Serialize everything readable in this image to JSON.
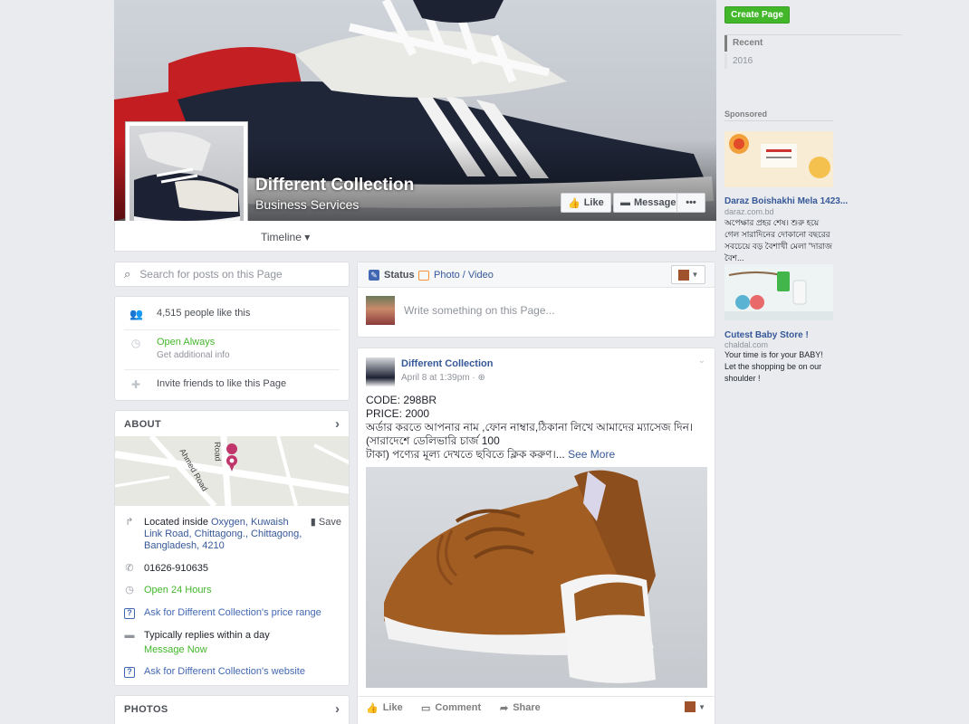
{
  "header": {
    "page_name": "Different Collection",
    "category": "Business Services",
    "like_label": "Like",
    "message_label": "Message",
    "more_label": "•••",
    "timeline_tab": "Timeline ▾"
  },
  "left": {
    "search_placeholder": "Search for posts on this Page",
    "likes_text": "4,515 people like this",
    "hours_status": "Open Always",
    "add_info": "Get additional info",
    "invite": "Invite friends to like this Page",
    "about_title": "ABOUT",
    "map_labels": [
      "Road",
      "Ahmed Road"
    ],
    "located_prefix": "Located inside ",
    "located_link": "Oxygen, Kuwaish Link Road, Chittagong., Chittagong, Bangladesh, 4210",
    "save_label": "Save",
    "phone": "01626-910635",
    "hours": "Open 24 Hours",
    "price_range": "Ask for Different Collection's price range",
    "replies": "Typically replies within a day",
    "message_now": "Message Now",
    "website": "Ask for Different Collection's website",
    "photos_title": "PHOTOS"
  },
  "composer": {
    "status_tab": "Status",
    "photo_tab": "Photo / Video",
    "placeholder": "Write something on this Page..."
  },
  "post": {
    "author": "Different Collection",
    "time": "April 8 at 1:39pm · ",
    "lines": [
      "CODE: 298BR",
      "PRICE: 2000",
      "অর্ডার করতে আপনার নাম ,ফোন নাম্বার,ঠিকানা লিখে আমাদের ম্যাসেজ দিন।",
      "(সারাদেশে ডেলিভারি চার্জ 100",
      "টাকা) পণ্যের মূল্য দেখতে ছবিতে ক্লিক করুণ।..."
    ],
    "see_more": "See More",
    "actions": [
      "Like",
      "Comment",
      "Share"
    ]
  },
  "right": {
    "create_page": "Create Page",
    "recent": "Recent",
    "year": "2016",
    "sponsored": "Sponsored",
    "ads": [
      {
        "title": "Daraz Boishakhi Mela 1423...",
        "url": "daraz.com.bd",
        "body": "অপেক্ষার প্রহর শেষ। শুরু হয়ে গেল সারাদিনের দোকানো বছরের সবচেয়ে বড় বৈশাখী মেলা \"দারাজ বৈশ..."
      },
      {
        "title": "Cutest Baby Store !",
        "url": "chaldal.com",
        "body": "Your time is for your BABY! Let the shopping be on our shoulder !"
      }
    ]
  },
  "colors": {
    "fb_blue": "#4267b2",
    "link": "#365899",
    "green": "#42b72a",
    "background": "#e9ebee"
  }
}
